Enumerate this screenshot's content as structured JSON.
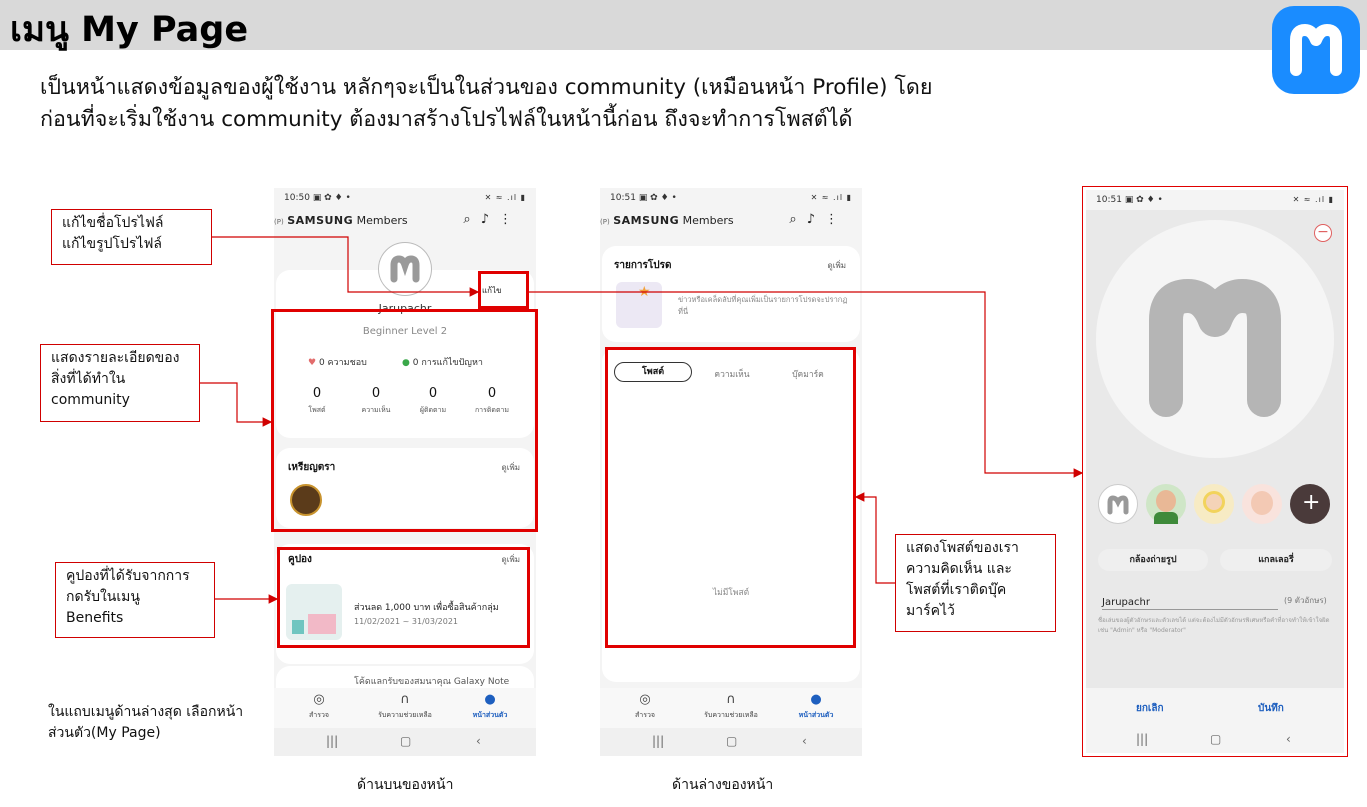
{
  "page": {
    "title": "เมนู My Page",
    "description_line1": "เป็นหน้าแสดงข้อมูลของผู้ใช้งาน หลักๆจะเป็นในส่วนของ community (เหมือนหน้า Profile) โดย",
    "description_line2": "ก่อนที่จะเริ่มใช้งาน community ต้องมาสร้างโปรไฟล์ในหน้านี้ก่อน ถึงจะทำการโพสต์ได้",
    "caption_top": "ด้านบนของหน้า",
    "caption_bottom": "ด้านล่างของหน้า",
    "colors": {
      "accent": "#1a8cff",
      "annotation": "#e00000",
      "active_nav": "#1e5fbf"
    }
  },
  "notes": {
    "edit_profile": "แก้ไขชื่อโปรไฟล์\nแก้ไขรูปโปรไฟล์",
    "activity": "แสดงรายละเอียดของ\nสิ่งที่ได้ทำใน\ncommunity",
    "coupons": "คูปองที่ได้รับจากการ\nกดรับในเมนู\nBenefits",
    "posts": "แสดงโพสต์ของเรา\nความคิดเห็น และ\nโพสต์ที่เราติดบุ๊ค\nมาร์คไว้",
    "bottom_menu": "ในแถบเมนูด้านล่างสุด เลือกหน้า\nส่วนตัว(My Page)"
  },
  "phone1": {
    "time": "10:50",
    "status_icons": "▣ ✿ ♦ •",
    "signal": "✕ ≈ .ıl ▮",
    "app_prefix": "(P)",
    "app_brand": "SAMSUNG",
    "app_name": "Members",
    "username": "Jarupachr",
    "level": "Beginner Level 2",
    "edit_button": "แก้ไข",
    "likes": "0 ความชอบ",
    "solutions": "0 การแก้ไขปัญหา",
    "stats": [
      {
        "value": "0",
        "label": "โพสต์"
      },
      {
        "value": "0",
        "label": "ความเห็น"
      },
      {
        "value": "0",
        "label": "ผู้ติดตาม"
      },
      {
        "value": "0",
        "label": "การติดตาม"
      }
    ],
    "badges_title": "เหรียญตรา",
    "see_more": "ดูเพิ่ม",
    "coupons_title": "คูปอง",
    "coupon_title": "ส่วนลด 1,000 บาท เพื่อซื้อสินค้ากลุ่ม",
    "coupon_dates": "11/02/2021 ~ 31/03/2021",
    "coupon2_title": "โค้ดแลกรับของสมนาคุณ Galaxy Note",
    "nav": [
      {
        "icon": "compass-icon",
        "label": "สำรวจ"
      },
      {
        "icon": "headset-icon",
        "label": "รับความช่วยเหลือ"
      },
      {
        "icon": "person-icon",
        "label": "หน้าส่วนตัว"
      }
    ]
  },
  "phone2": {
    "time": "10:51",
    "status_icons": "▣ ✿ ♦ •",
    "signal": "✕ ≈ .ıl ▮",
    "app_prefix": "(P)",
    "app_brand": "SAMSUNG",
    "app_name": "Members",
    "favorites_title": "รายการโปรด",
    "see_more": "ดูเพิ่ม",
    "favorites_desc": "ข่าวหรือเคล็ดลับที่คุณเพิ่มเป็นรายการโปรดจะปรากฏที่นี่",
    "tabs": [
      "โพสต์",
      "ความเห็น",
      "บุ๊คมาร์ค"
    ],
    "empty": "ไม่มีโพสต์",
    "nav": [
      {
        "icon": "compass-icon",
        "label": "สำรวจ"
      },
      {
        "icon": "headset-icon",
        "label": "รับความช่วยเหลือ"
      },
      {
        "icon": "person-icon",
        "label": "หน้าส่วนตัว"
      }
    ]
  },
  "phone3": {
    "time": "10:51",
    "status_icons": "▣ ✿ ♦ •",
    "signal": "✕ ≈ .ıl ▮",
    "camera_button": "กล้องถ่ายรูป",
    "gallery_button": "แกลเลอรี่",
    "name_value": "Jarupachr",
    "char_count": "(9 ตัวอักษร)",
    "hint": "ชื่อเล่นของผู้ตัวอักษรและตัวเลขได้ แต่จะต้องไม่มีตัวอักษรพิเศษหรือคำที่อาจทำให้เข้าใจผิด เช่น \"Admin\" หรือ \"Moderator\"",
    "cancel": "ยกเลิก",
    "save": "บันทึก"
  }
}
